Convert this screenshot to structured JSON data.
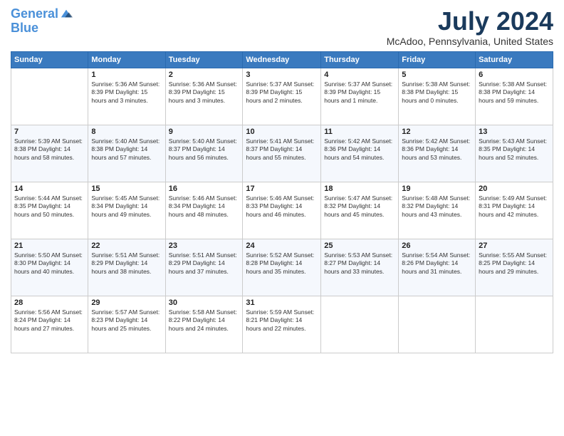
{
  "header": {
    "logo_line1": "General",
    "logo_line2": "Blue",
    "month_year": "July 2024",
    "location": "McAdoo, Pennsylvania, United States"
  },
  "days_of_week": [
    "Sunday",
    "Monday",
    "Tuesday",
    "Wednesday",
    "Thursday",
    "Friday",
    "Saturday"
  ],
  "weeks": [
    [
      {
        "day": "",
        "info": ""
      },
      {
        "day": "1",
        "info": "Sunrise: 5:36 AM\nSunset: 8:39 PM\nDaylight: 15 hours\nand 3 minutes."
      },
      {
        "day": "2",
        "info": "Sunrise: 5:36 AM\nSunset: 8:39 PM\nDaylight: 15 hours\nand 3 minutes."
      },
      {
        "day": "3",
        "info": "Sunrise: 5:37 AM\nSunset: 8:39 PM\nDaylight: 15 hours\nand 2 minutes."
      },
      {
        "day": "4",
        "info": "Sunrise: 5:37 AM\nSunset: 8:39 PM\nDaylight: 15 hours\nand 1 minute."
      },
      {
        "day": "5",
        "info": "Sunrise: 5:38 AM\nSunset: 8:38 PM\nDaylight: 15 hours\nand 0 minutes."
      },
      {
        "day": "6",
        "info": "Sunrise: 5:38 AM\nSunset: 8:38 PM\nDaylight: 14 hours\nand 59 minutes."
      }
    ],
    [
      {
        "day": "7",
        "info": "Sunrise: 5:39 AM\nSunset: 8:38 PM\nDaylight: 14 hours\nand 58 minutes."
      },
      {
        "day": "8",
        "info": "Sunrise: 5:40 AM\nSunset: 8:38 PM\nDaylight: 14 hours\nand 57 minutes."
      },
      {
        "day": "9",
        "info": "Sunrise: 5:40 AM\nSunset: 8:37 PM\nDaylight: 14 hours\nand 56 minutes."
      },
      {
        "day": "10",
        "info": "Sunrise: 5:41 AM\nSunset: 8:37 PM\nDaylight: 14 hours\nand 55 minutes."
      },
      {
        "day": "11",
        "info": "Sunrise: 5:42 AM\nSunset: 8:36 PM\nDaylight: 14 hours\nand 54 minutes."
      },
      {
        "day": "12",
        "info": "Sunrise: 5:42 AM\nSunset: 8:36 PM\nDaylight: 14 hours\nand 53 minutes."
      },
      {
        "day": "13",
        "info": "Sunrise: 5:43 AM\nSunset: 8:35 PM\nDaylight: 14 hours\nand 52 minutes."
      }
    ],
    [
      {
        "day": "14",
        "info": "Sunrise: 5:44 AM\nSunset: 8:35 PM\nDaylight: 14 hours\nand 50 minutes."
      },
      {
        "day": "15",
        "info": "Sunrise: 5:45 AM\nSunset: 8:34 PM\nDaylight: 14 hours\nand 49 minutes."
      },
      {
        "day": "16",
        "info": "Sunrise: 5:46 AM\nSunset: 8:34 PM\nDaylight: 14 hours\nand 48 minutes."
      },
      {
        "day": "17",
        "info": "Sunrise: 5:46 AM\nSunset: 8:33 PM\nDaylight: 14 hours\nand 46 minutes."
      },
      {
        "day": "18",
        "info": "Sunrise: 5:47 AM\nSunset: 8:32 PM\nDaylight: 14 hours\nand 45 minutes."
      },
      {
        "day": "19",
        "info": "Sunrise: 5:48 AM\nSunset: 8:32 PM\nDaylight: 14 hours\nand 43 minutes."
      },
      {
        "day": "20",
        "info": "Sunrise: 5:49 AM\nSunset: 8:31 PM\nDaylight: 14 hours\nand 42 minutes."
      }
    ],
    [
      {
        "day": "21",
        "info": "Sunrise: 5:50 AM\nSunset: 8:30 PM\nDaylight: 14 hours\nand 40 minutes."
      },
      {
        "day": "22",
        "info": "Sunrise: 5:51 AM\nSunset: 8:29 PM\nDaylight: 14 hours\nand 38 minutes."
      },
      {
        "day": "23",
        "info": "Sunrise: 5:51 AM\nSunset: 8:29 PM\nDaylight: 14 hours\nand 37 minutes."
      },
      {
        "day": "24",
        "info": "Sunrise: 5:52 AM\nSunset: 8:28 PM\nDaylight: 14 hours\nand 35 minutes."
      },
      {
        "day": "25",
        "info": "Sunrise: 5:53 AM\nSunset: 8:27 PM\nDaylight: 14 hours\nand 33 minutes."
      },
      {
        "day": "26",
        "info": "Sunrise: 5:54 AM\nSunset: 8:26 PM\nDaylight: 14 hours\nand 31 minutes."
      },
      {
        "day": "27",
        "info": "Sunrise: 5:55 AM\nSunset: 8:25 PM\nDaylight: 14 hours\nand 29 minutes."
      }
    ],
    [
      {
        "day": "28",
        "info": "Sunrise: 5:56 AM\nSunset: 8:24 PM\nDaylight: 14 hours\nand 27 minutes."
      },
      {
        "day": "29",
        "info": "Sunrise: 5:57 AM\nSunset: 8:23 PM\nDaylight: 14 hours\nand 25 minutes."
      },
      {
        "day": "30",
        "info": "Sunrise: 5:58 AM\nSunset: 8:22 PM\nDaylight: 14 hours\nand 24 minutes."
      },
      {
        "day": "31",
        "info": "Sunrise: 5:59 AM\nSunset: 8:21 PM\nDaylight: 14 hours\nand 22 minutes."
      },
      {
        "day": "",
        "info": ""
      },
      {
        "day": "",
        "info": ""
      },
      {
        "day": "",
        "info": ""
      }
    ]
  ]
}
